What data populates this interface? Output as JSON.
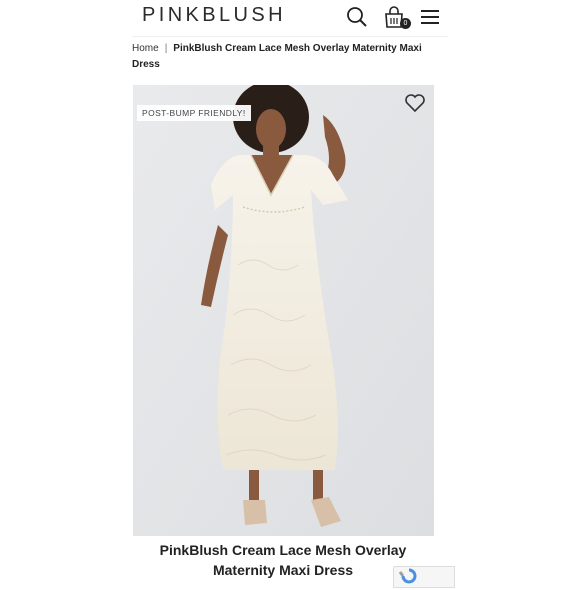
{
  "header": {
    "logo": "PINKBLUSH",
    "cart_count": "0",
    "icons": [
      "search-icon",
      "shopping-bag-icon",
      "hamburger-menu-icon"
    ]
  },
  "breadcrumb": {
    "home": "Home",
    "separator": "|",
    "current": "PinkBlush Cream Lace Mesh Overlay Maternity Maxi Dress"
  },
  "product": {
    "badge": "POST-BUMP FRIENDLY!",
    "title": "PinkBlush Cream Lace Mesh Overlay Maternity Maxi Dress",
    "image_icon": "wishlist-heart-icon"
  },
  "colors": {
    "image_bg": "#e4e5e7",
    "dress": "#f4f0e6",
    "text": "#222222"
  }
}
